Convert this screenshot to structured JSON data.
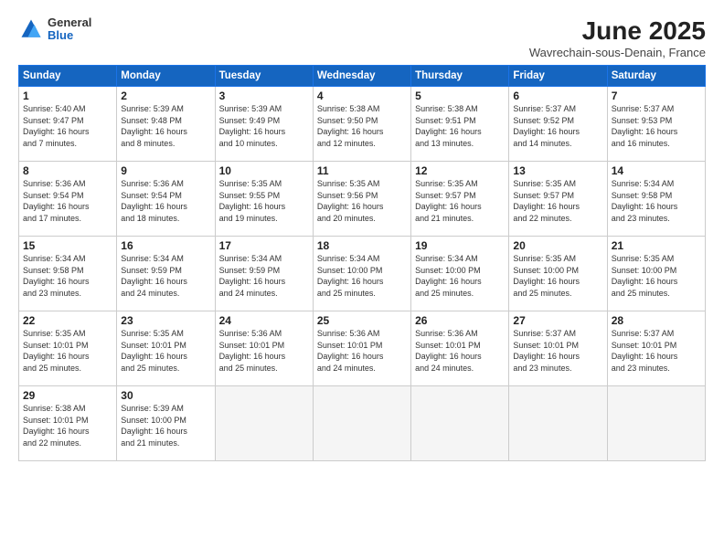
{
  "header": {
    "logo": {
      "general": "General",
      "blue": "Blue"
    },
    "title": "June 2025",
    "location": "Wavrechain-sous-Denain, France"
  },
  "weekdays": [
    "Sunday",
    "Monday",
    "Tuesday",
    "Wednesday",
    "Thursday",
    "Friday",
    "Saturday"
  ],
  "days": [
    {
      "num": "",
      "info": ""
    },
    {
      "num": "",
      "info": ""
    },
    {
      "num": "",
      "info": ""
    },
    {
      "num": "",
      "info": ""
    },
    {
      "num": "",
      "info": ""
    },
    {
      "num": "",
      "info": ""
    },
    {
      "num": "1",
      "info": "Sunrise: 5:40 AM\nSunset: 9:47 PM\nDaylight: 16 hours\nand 7 minutes."
    },
    {
      "num": "2",
      "info": "Sunrise: 5:39 AM\nSunset: 9:48 PM\nDaylight: 16 hours\nand 8 minutes."
    },
    {
      "num": "3",
      "info": "Sunrise: 5:39 AM\nSunset: 9:49 PM\nDaylight: 16 hours\nand 10 minutes."
    },
    {
      "num": "4",
      "info": "Sunrise: 5:38 AM\nSunset: 9:50 PM\nDaylight: 16 hours\nand 12 minutes."
    },
    {
      "num": "5",
      "info": "Sunrise: 5:38 AM\nSunset: 9:51 PM\nDaylight: 16 hours\nand 13 minutes."
    },
    {
      "num": "6",
      "info": "Sunrise: 5:37 AM\nSunset: 9:52 PM\nDaylight: 16 hours\nand 14 minutes."
    },
    {
      "num": "7",
      "info": "Sunrise: 5:37 AM\nSunset: 9:53 PM\nDaylight: 16 hours\nand 16 minutes."
    },
    {
      "num": "8",
      "info": "Sunrise: 5:36 AM\nSunset: 9:54 PM\nDaylight: 16 hours\nand 17 minutes."
    },
    {
      "num": "9",
      "info": "Sunrise: 5:36 AM\nSunset: 9:54 PM\nDaylight: 16 hours\nand 18 minutes."
    },
    {
      "num": "10",
      "info": "Sunrise: 5:35 AM\nSunset: 9:55 PM\nDaylight: 16 hours\nand 19 minutes."
    },
    {
      "num": "11",
      "info": "Sunrise: 5:35 AM\nSunset: 9:56 PM\nDaylight: 16 hours\nand 20 minutes."
    },
    {
      "num": "12",
      "info": "Sunrise: 5:35 AM\nSunset: 9:57 PM\nDaylight: 16 hours\nand 21 minutes."
    },
    {
      "num": "13",
      "info": "Sunrise: 5:35 AM\nSunset: 9:57 PM\nDaylight: 16 hours\nand 22 minutes."
    },
    {
      "num": "14",
      "info": "Sunrise: 5:34 AM\nSunset: 9:58 PM\nDaylight: 16 hours\nand 23 minutes."
    },
    {
      "num": "15",
      "info": "Sunrise: 5:34 AM\nSunset: 9:58 PM\nDaylight: 16 hours\nand 23 minutes."
    },
    {
      "num": "16",
      "info": "Sunrise: 5:34 AM\nSunset: 9:59 PM\nDaylight: 16 hours\nand 24 minutes."
    },
    {
      "num": "17",
      "info": "Sunrise: 5:34 AM\nSunset: 9:59 PM\nDaylight: 16 hours\nand 24 minutes."
    },
    {
      "num": "18",
      "info": "Sunrise: 5:34 AM\nSunset: 10:00 PM\nDaylight: 16 hours\nand 25 minutes."
    },
    {
      "num": "19",
      "info": "Sunrise: 5:34 AM\nSunset: 10:00 PM\nDaylight: 16 hours\nand 25 minutes."
    },
    {
      "num": "20",
      "info": "Sunrise: 5:35 AM\nSunset: 10:00 PM\nDaylight: 16 hours\nand 25 minutes."
    },
    {
      "num": "21",
      "info": "Sunrise: 5:35 AM\nSunset: 10:00 PM\nDaylight: 16 hours\nand 25 minutes."
    },
    {
      "num": "22",
      "info": "Sunrise: 5:35 AM\nSunset: 10:01 PM\nDaylight: 16 hours\nand 25 minutes."
    },
    {
      "num": "23",
      "info": "Sunrise: 5:35 AM\nSunset: 10:01 PM\nDaylight: 16 hours\nand 25 minutes."
    },
    {
      "num": "24",
      "info": "Sunrise: 5:36 AM\nSunset: 10:01 PM\nDaylight: 16 hours\nand 25 minutes."
    },
    {
      "num": "25",
      "info": "Sunrise: 5:36 AM\nSunset: 10:01 PM\nDaylight: 16 hours\nand 24 minutes."
    },
    {
      "num": "26",
      "info": "Sunrise: 5:36 AM\nSunset: 10:01 PM\nDaylight: 16 hours\nand 24 minutes."
    },
    {
      "num": "27",
      "info": "Sunrise: 5:37 AM\nSunset: 10:01 PM\nDaylight: 16 hours\nand 23 minutes."
    },
    {
      "num": "28",
      "info": "Sunrise: 5:37 AM\nSunset: 10:01 PM\nDaylight: 16 hours\nand 23 minutes."
    },
    {
      "num": "29",
      "info": "Sunrise: 5:38 AM\nSunset: 10:01 PM\nDaylight: 16 hours\nand 22 minutes."
    },
    {
      "num": "30",
      "info": "Sunrise: 5:39 AM\nSunset: 10:00 PM\nDaylight: 16 hours\nand 21 minutes."
    },
    {
      "num": "",
      "info": ""
    },
    {
      "num": "",
      "info": ""
    },
    {
      "num": "",
      "info": ""
    },
    {
      "num": "",
      "info": ""
    },
    {
      "num": "",
      "info": ""
    }
  ]
}
